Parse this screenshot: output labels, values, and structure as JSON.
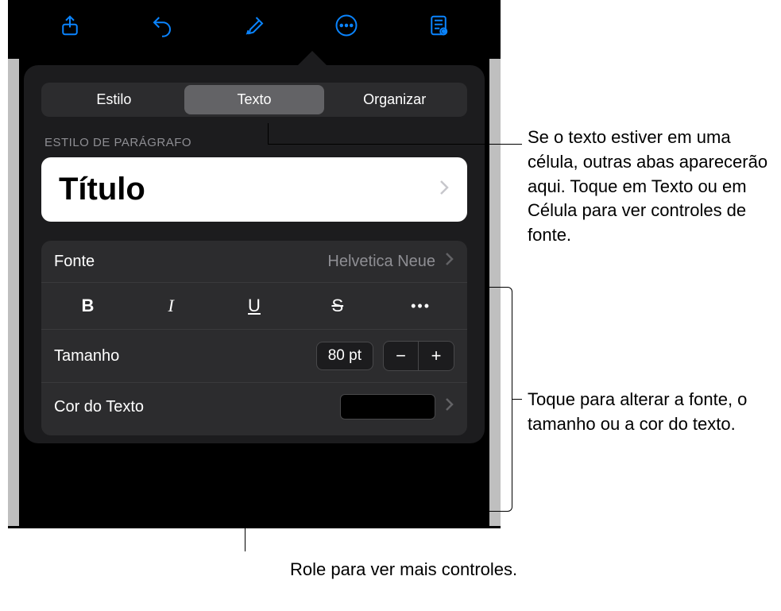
{
  "toolbar": {
    "icons": [
      "share",
      "undo",
      "format",
      "more",
      "view"
    ]
  },
  "segmented": {
    "items": [
      {
        "label": "Estilo",
        "active": false
      },
      {
        "label": "Texto",
        "active": true
      },
      {
        "label": "Organizar",
        "active": false
      }
    ]
  },
  "paragraph_style": {
    "section_label": "ESTILO DE PARÁGRAFO",
    "value": "Título"
  },
  "font_row": {
    "label": "Fonte",
    "value": "Helvetica Neue"
  },
  "style_buttons": {
    "bold": "B",
    "italic": "I",
    "underline": "U",
    "strike": "S",
    "more": "•••"
  },
  "size_row": {
    "label": "Tamanho",
    "value": "80 pt"
  },
  "color_row": {
    "label": "Cor do Texto",
    "swatch": "#000000"
  },
  "callouts": {
    "tabs": "Se o texto estiver em uma célula, outras abas aparecerão aqui. Toque em Texto ou em Célula para ver controles de fonte.",
    "font_controls": "Toque para alterar a fonte, o tamanho ou a cor do texto.",
    "scroll": "Role para ver mais controles."
  }
}
